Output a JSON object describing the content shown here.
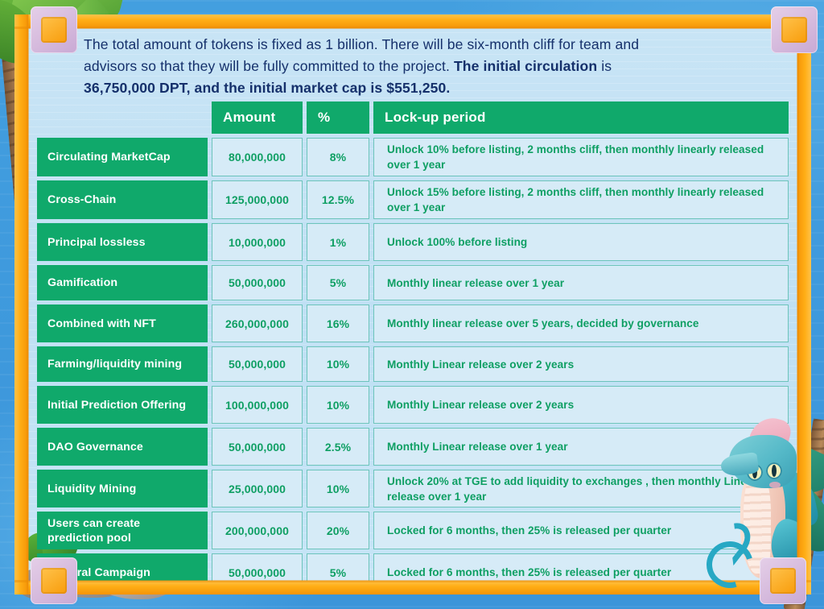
{
  "intro": {
    "line1": "The total amount of tokens is fixed as 1 billion. There will be six-month cliff for team and",
    "line2_a": "advisors so that they will be fully committed to the project. ",
    "line2_bold": "The initial circulation",
    "line2_b": " is",
    "line3": "36,750,000 DPT, and the initial market cap is $551,250."
  },
  "table": {
    "headers": {
      "name": "",
      "amount": "Amount",
      "percent": "%",
      "lockup": "Lock-up period"
    },
    "rows": [
      {
        "name": "Circulating MarketCap",
        "amount": "80,000,000",
        "percent": "8%",
        "lockup": "Unlock 10% before listing, 2 months cliff, then monthly linearly released over 1 year"
      },
      {
        "name": "Cross-Chain",
        "amount": "125,000,000",
        "percent": "12.5%",
        "lockup": "Unlock 15% before listing, 2 months cliff, then monthly linearly released over 1 year"
      },
      {
        "name": "Principal lossless",
        "amount": "10,000,000",
        "percent": "1%",
        "lockup": "Unlock 100% before listing"
      },
      {
        "name": "Gamification",
        "amount": "50,000,000",
        "percent": "5%",
        "lockup": "Monthly linear release over 1 year"
      },
      {
        "name": "Combined with NFT",
        "amount": "260,000,000",
        "percent": "16%",
        "lockup": "Monthly linear release over 5 years, decided by governance"
      },
      {
        "name": "Farming/liquidity mining",
        "amount": "50,000,000",
        "percent": "10%",
        "lockup": "Monthly Linear release over 2 years"
      },
      {
        "name": "Initial Prediction Offering",
        "amount": "100,000,000",
        "percent": "10%",
        "lockup": "Monthly Linear release over 2 years"
      },
      {
        "name": "DAO Governance",
        "amount": "50,000,000",
        "percent": "2.5%",
        "lockup": "Monthly Linear release over 1 year"
      },
      {
        "name": "Liquidity Mining",
        "amount": "25,000,000",
        "percent": "10%",
        "lockup": "Unlock 20% at TGE to add liquidity to exchanges , then monthly Linear release over 1 year"
      },
      {
        "name": "Users can create prediction pool",
        "amount": "200,000,000",
        "percent": "20%",
        "lockup": "Locked for 6 months, then 25% is released per quarter"
      },
      {
        "name": "Referral Campaign",
        "amount": "50,000,000",
        "percent": "5%",
        "lockup": "Locked for 6 months, then 25% is released per quarter"
      }
    ]
  },
  "colors": {
    "green": "#10a96b",
    "cell_bg": "#d6ebf7",
    "cell_border": "#6cc4bb",
    "text_green": "#0e9f63",
    "panel_bg": "#c6e5f6",
    "frame_orange": "#ffae16",
    "sky_blue": "#3f9bdd",
    "ornament": "#d4b4dd",
    "intro_text": "#15306b"
  }
}
